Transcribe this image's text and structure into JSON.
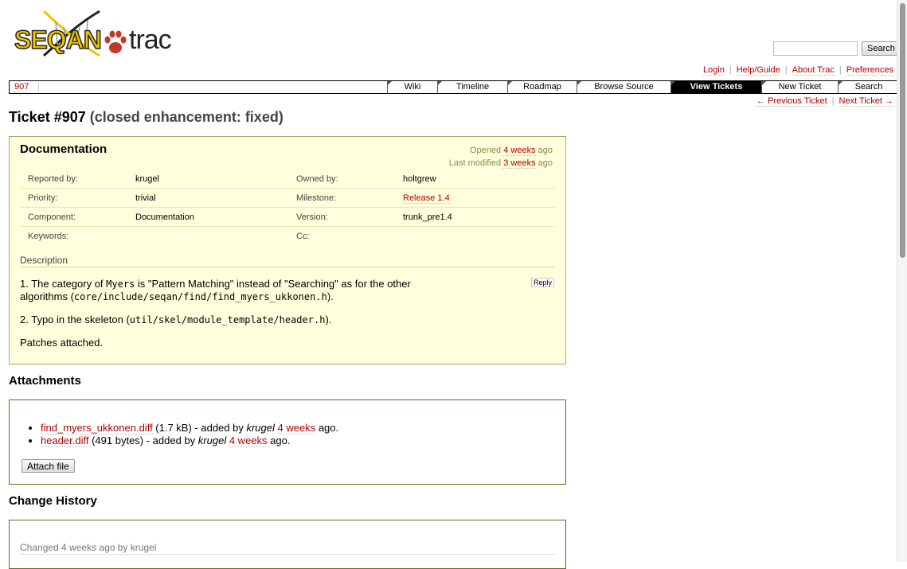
{
  "logo": {
    "brand": "SEQAN",
    "product": "trac"
  },
  "search": {
    "button_label": "Search",
    "value": ""
  },
  "metanav": [
    "Login",
    "Help/Guide",
    "About Trac",
    "Preferences"
  ],
  "context": "907",
  "mainnav": [
    "Wiki",
    "Timeline",
    "Roadmap",
    "Browse Source",
    "View Tickets",
    "New Ticket",
    "Search"
  ],
  "mainnav_active": "View Tickets",
  "ticketnav": {
    "prev": "← Previous Ticket",
    "next": "Next Ticket →"
  },
  "ticket": {
    "title": "Ticket #907",
    "status": "(closed enhancement: fixed)",
    "summary": "Documentation",
    "opened_prefix": "Opened",
    "opened_age": "4 weeks",
    "opened_suffix": "ago",
    "modified_prefix": "Last modified",
    "modified_age": "3 weeks",
    "modified_suffix": "ago",
    "props": {
      "reported_by_label": "Reported by:",
      "reported_by": "krugel",
      "owned_by_label": "Owned by:",
      "owned_by": "holtgrew",
      "priority_label": "Priority:",
      "priority": "trivial",
      "milestone_label": "Milestone:",
      "milestone": "Release 1.4",
      "component_label": "Component:",
      "component": "Documentation",
      "version_label": "Version:",
      "version": "trunk_pre1.4",
      "keywords_label": "Keywords:",
      "keywords": "",
      "cc_label": "Cc:",
      "cc": ""
    },
    "description_title": "Description",
    "reply_label": "Reply",
    "desc": {
      "p1a": "1. The category of ",
      "p1b": "Myers",
      "p1c": " is \"Pattern Matching\" instead of \"Searching\" as for the other",
      "p1d": "algorithms (",
      "p1e": "core/include/seqan/find/find_myers_ukkonen.h",
      "p1f": ").",
      "p2a": "2. Typo in the skeleton (",
      "p2b": "util/skel/module_template/header.h",
      "p2c": ").",
      "p3": "Patches attached."
    }
  },
  "attachments": {
    "title": "Attachments",
    "items": [
      {
        "name": "find_myers_ukkonen.diff",
        "size": " (1.7 kB) - added by ",
        "author": "krugel",
        "age": "4 weeks",
        "suffix": " ago."
      },
      {
        "name": "header.diff",
        "size": " (491 bytes) - added by ",
        "author": "krugel",
        "age": "4 weeks",
        "suffix": " ago."
      }
    ],
    "attach_button": "Attach file"
  },
  "history": {
    "title": "Change History",
    "first_change": "Changed 4 weeks ago by krugel"
  }
}
